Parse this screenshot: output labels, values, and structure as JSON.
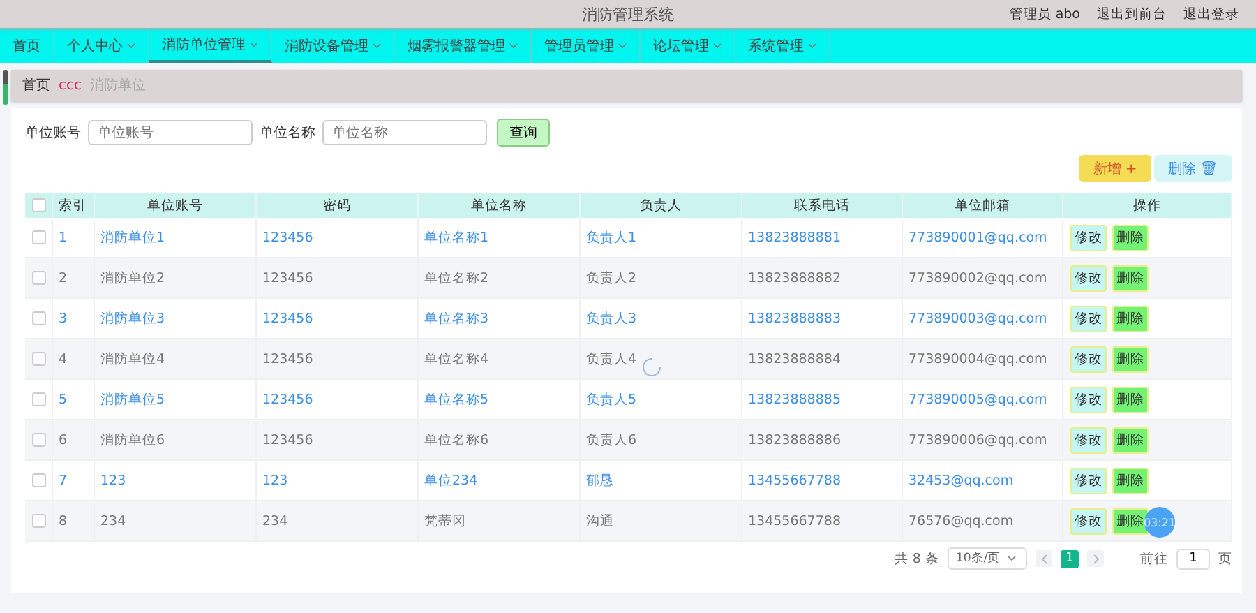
{
  "header": {
    "title": "消防管理系统",
    "user": "管理员 abo",
    "links": [
      "退出到前台",
      "退出登录"
    ]
  },
  "nav": [
    {
      "label": "首页",
      "dropdown": false,
      "selected": false
    },
    {
      "label": "个人中心",
      "dropdown": true,
      "selected": false
    },
    {
      "label": "消防单位管理",
      "dropdown": true,
      "selected": true
    },
    {
      "label": "消防设备管理",
      "dropdown": true,
      "selected": false
    },
    {
      "label": "烟雾报警器管理",
      "dropdown": true,
      "selected": false
    },
    {
      "label": "管理员管理",
      "dropdown": true,
      "selected": false
    },
    {
      "label": "论坛管理",
      "dropdown": true,
      "selected": false
    },
    {
      "label": "系统管理",
      "dropdown": true,
      "selected": false
    }
  ],
  "breadcrumb": {
    "home": "首页",
    "separator": "ccc",
    "current": "消防单位"
  },
  "search": {
    "fields": [
      {
        "label": "单位账号",
        "placeholder": "单位账号"
      },
      {
        "label": "单位名称",
        "placeholder": "单位名称"
      }
    ],
    "button": "查询"
  },
  "actions": {
    "add": "新增 +",
    "delete": "删除 🗑"
  },
  "table": {
    "columns": [
      "索引",
      "单位账号",
      "密码",
      "单位名称",
      "负责人",
      "联系电话",
      "单位邮箱",
      "操作"
    ],
    "select_all_checked": false,
    "rows": [
      {
        "checked": false,
        "cells": [
          "1",
          "消防单位1",
          "123456",
          "单位名称1",
          "负责人1",
          "13823888881",
          "773890001@qq.com"
        ],
        "actions": [
          "修改",
          "删除"
        ]
      },
      {
        "checked": false,
        "cells": [
          "2",
          "消防单位2",
          "123456",
          "单位名称2",
          "负责人2",
          "13823888882",
          "773890002@qq.com"
        ],
        "actions": [
          "修改",
          "删除"
        ]
      },
      {
        "checked": false,
        "cells": [
          "3",
          "消防单位3",
          "123456",
          "单位名称3",
          "负责人3",
          "13823888883",
          "773890003@qq.com"
        ],
        "actions": [
          "修改",
          "删除"
        ]
      },
      {
        "checked": false,
        "cells": [
          "4",
          "消防单位4",
          "123456",
          "单位名称4",
          "负责人4",
          "13823888884",
          "773890004@qq.com"
        ],
        "actions": [
          "修改",
          "删除"
        ]
      },
      {
        "checked": false,
        "cells": [
          "5",
          "消防单位5",
          "123456",
          "单位名称5",
          "负责人5",
          "13823888885",
          "773890005@qq.com"
        ],
        "actions": [
          "修改",
          "删除"
        ]
      },
      {
        "checked": false,
        "cells": [
          "6",
          "消防单位6",
          "123456",
          "单位名称6",
          "负责人6",
          "13823888886",
          "773890006@qq.com"
        ],
        "actions": [
          "修改",
          "删除"
        ]
      },
      {
        "checked": false,
        "cells": [
          "7",
          "123",
          "123",
          "单位234",
          "郁恳",
          "13455667788",
          "32453@qq.com"
        ],
        "actions": [
          "修改",
          "删除"
        ]
      },
      {
        "checked": false,
        "cells": [
          "8",
          "234",
          "234",
          "梵蒂冈",
          "沟通",
          "13455667788",
          "76576@qq.com"
        ],
        "actions": [
          "修改",
          "删除"
        ]
      }
    ]
  },
  "pagination": {
    "total": "共 8 条",
    "page_size": "10条/页",
    "pages": [
      {
        "label": "1",
        "selected": true
      }
    ],
    "goto_label": "前往",
    "goto_value": "1",
    "page_unit": "页"
  },
  "timer_badge": "03:21"
}
